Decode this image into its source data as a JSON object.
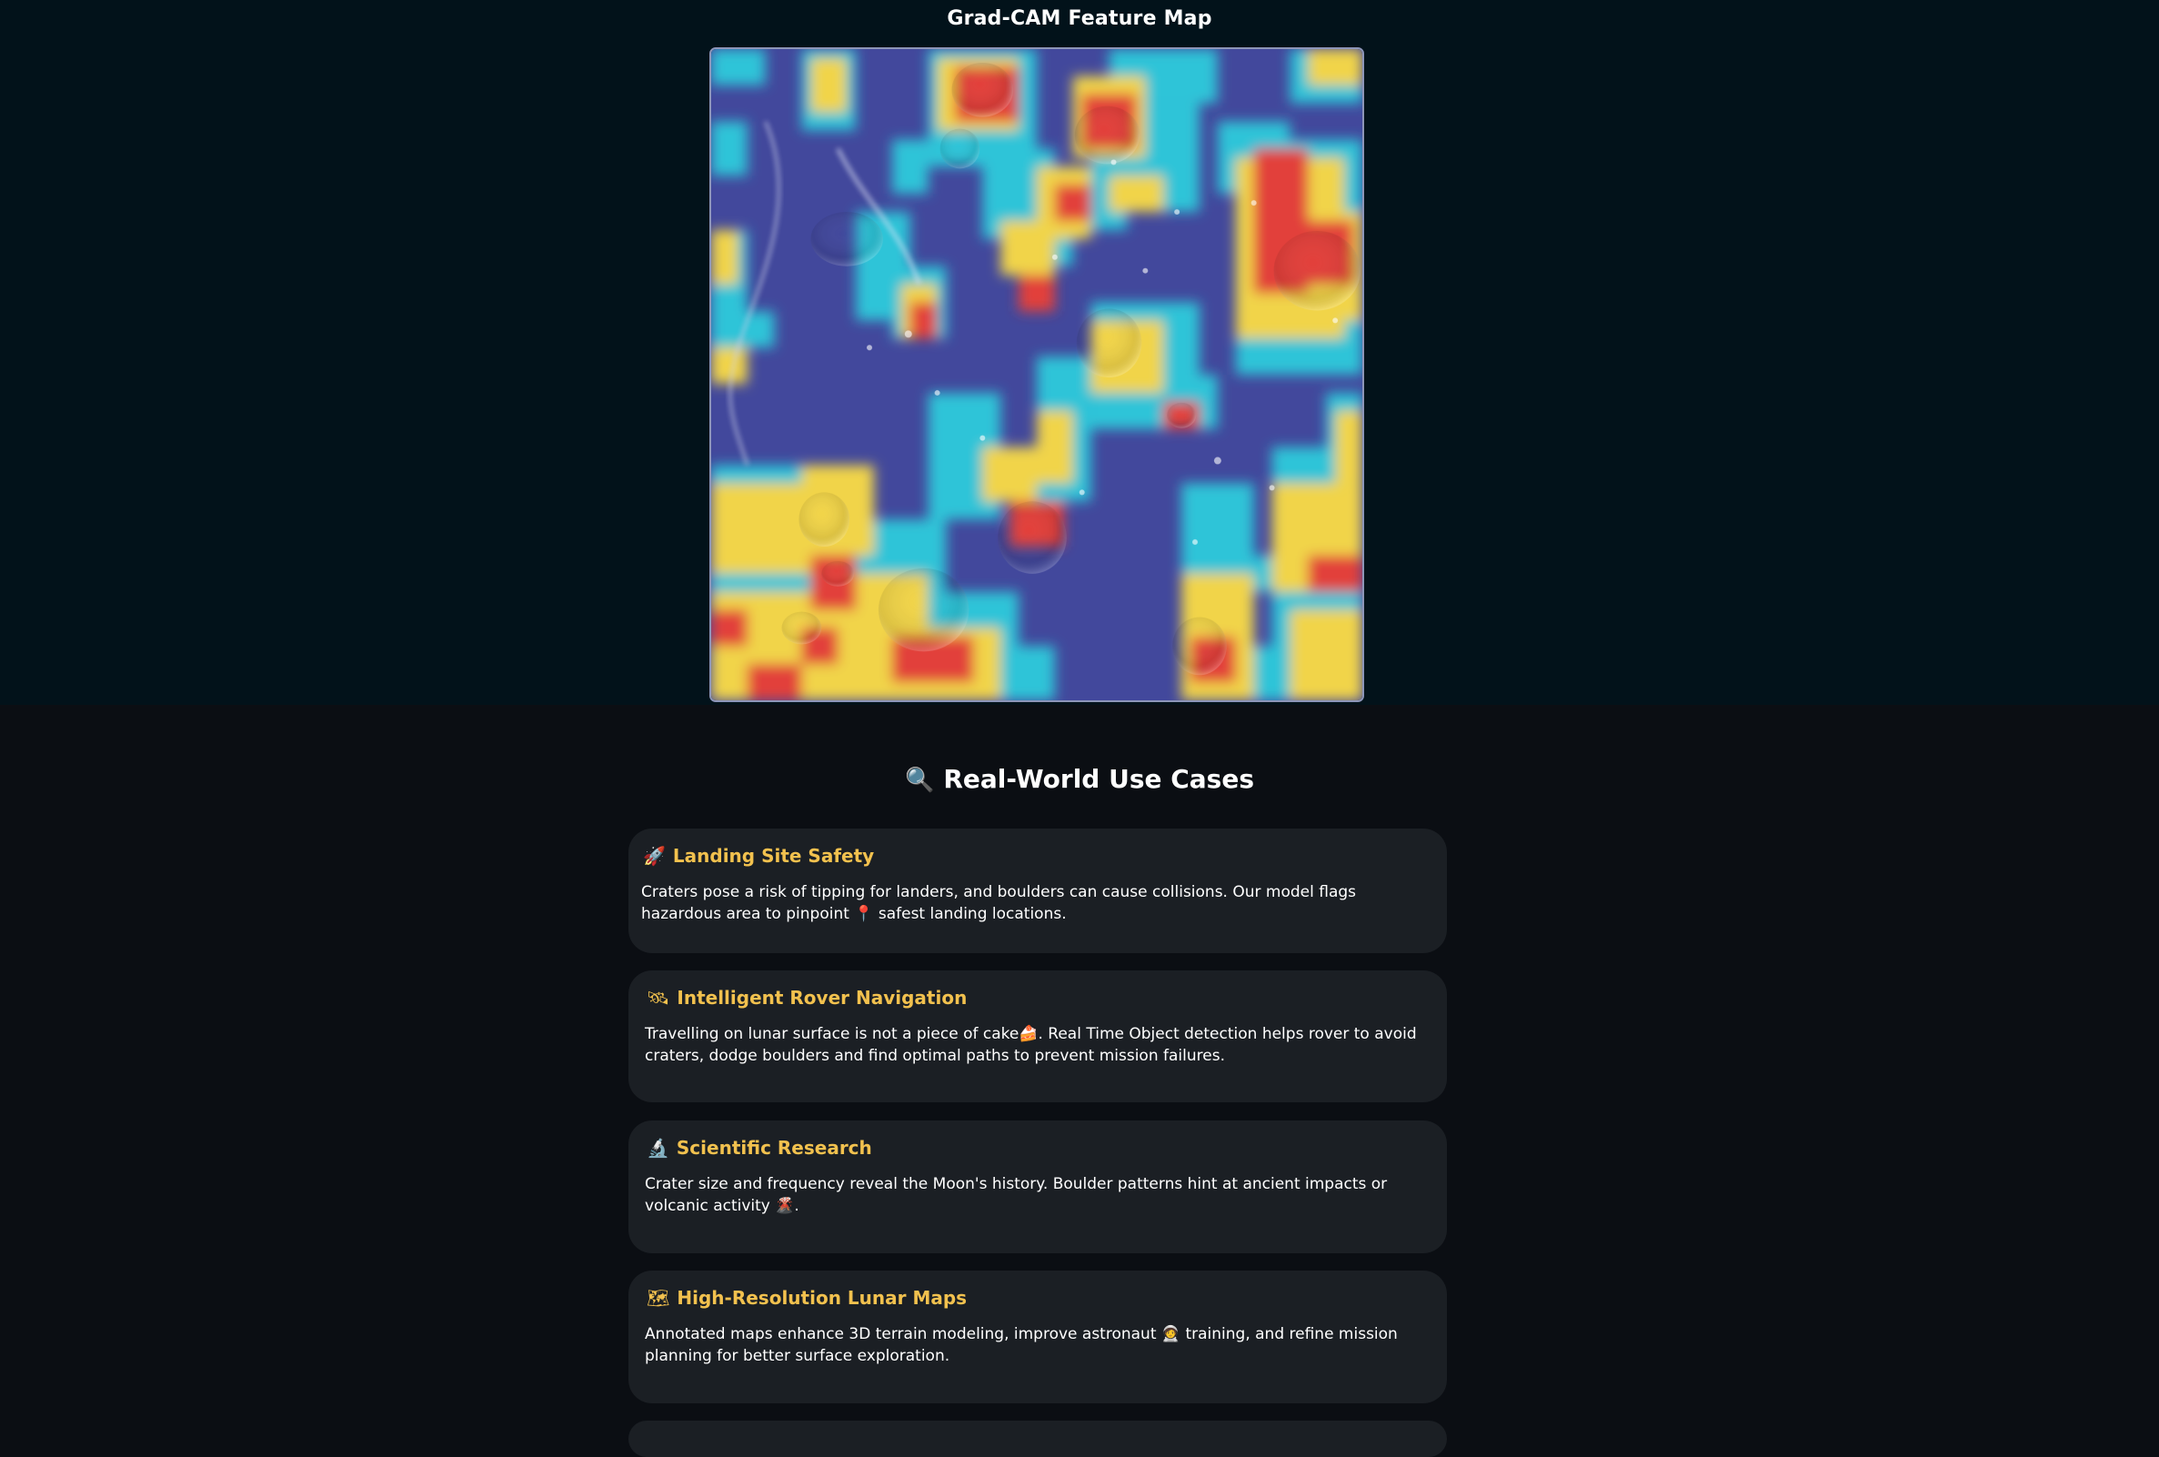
{
  "gradcam": {
    "title": "Grad-CAM Feature Map"
  },
  "use_cases": {
    "heading": "Real-World Use Cases",
    "heading_icon": "magnifier-icon",
    "items": [
      {
        "icon": "🚀",
        "title": "Landing Site Safety",
        "body": "Craters pose a risk of tipping for landers, and boulders can cause collisions. Our model flags hazardous area to pinpoint 📍 safest landing locations."
      },
      {
        "icon": "🛰",
        "title": "Intelligent Rover Navigation",
        "body": "Travelling on lunar surface is not a piece of cake🍰. Real Time Object detection helps rover to avoid craters, dodge boulders and find optimal paths to prevent mission failures."
      },
      {
        "icon": "🔬",
        "title": "Scientific Research",
        "body": "Crater size and frequency reveal the Moon's history. Boulder patterns hint at ancient impacts or volcanic activity 🌋."
      },
      {
        "icon": "🗺",
        "title": "High-Resolution Lunar Maps",
        "body": "Annotated maps enhance 3D terrain modeling, improve astronaut 🧑‍🚀 training, and refine mission planning for better surface exploration."
      }
    ]
  },
  "colors": {
    "top_bg": "#02121a",
    "page_bg": "#0b0e13",
    "card_bg": "#1b1f24",
    "card_title": "#f2c14e",
    "heatmap_low": "#3a3f9e",
    "heatmap_mid": "#27c6d9",
    "heatmap_warm": "#f0d24a",
    "heatmap_high": "#e2403a"
  }
}
